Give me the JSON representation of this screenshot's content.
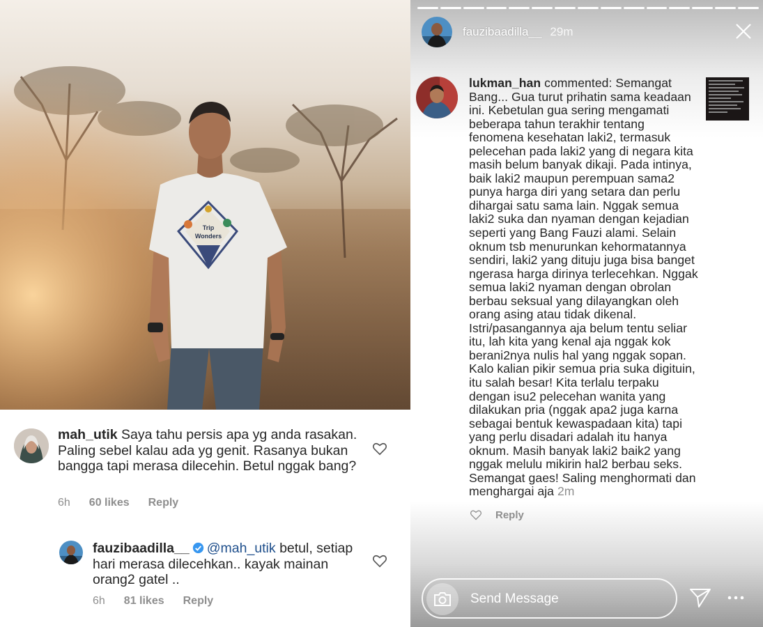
{
  "left_post": {
    "comments": [
      {
        "username": "mah_utik",
        "text": "Saya tahu persis apa yg anda rasakan. Paling sebel kalau ada yg genit. Rasanya bukan bangga tapi merasa dilecehin. Betul nggak bang?",
        "time": "6h",
        "likes": "60 likes",
        "reply": "Reply"
      },
      {
        "username": "fauzibaadilla__",
        "mention": "@mah_utik",
        "text": "betul, setiap hari merasa dilecehkan.. kayak mainan orang2 gatel ..",
        "time": "6h",
        "likes": "81 likes",
        "reply": "Reply"
      }
    ],
    "shirt_print": {
      "line1": "Trip",
      "line2": "Wonders"
    }
  },
  "story": {
    "username": "fauzibaadilla__",
    "time": "29m",
    "segments_total": 15,
    "segments_viewed": 15,
    "comment": {
      "username": "lukman_han",
      "text": "commented: Semangat Bang... Gua turut prihatin sama keadaan ini. Kebetulan gua sering mengamati beberapa tahun terakhir tentang fenomena kesehatan laki2, termasuk pelecehan pada laki2 yang di negara kita masih belum banyak dikaji. Pada intinya, baik laki2 maupun perempuan sama2 punya harga diri yang setara dan perlu dihargai satu sama lain. Nggak semua laki2 suka dan nyaman dengan kejadian seperti yang Bang Fauzi alami. Selain oknum tsb menurunkan kehormatannya sendiri, laki2 yang dituju juga bisa banget ngerasa harga dirinya terlecehkan. Nggak semua laki2 nyaman dengan obrolan berbau seksual yang dilayangkan oleh orang asing atau tidak dikenal. Istri/pasangannya aja belum tentu seliar itu, lah kita yang kenal aja nggak kok berani2nya nulis hal yang nggak sopan. Kalo kalian pikir semua pria suka digituin, itu salah besar! Kita terlalu terpaku dengan isu2 pelecehan wanita yang dilakukan pria (nggak apa2 juga karna sebagai bentuk kewaspadaan kita) tapi yang perlu disadari adalah itu hanya oknum. Masih banyak laki2 baik2 yang nggak melulu mikirin hal2 berbau seks. Semangat gaes! Saling menghormati dan menghargai aja",
      "time": "2m",
      "reply": "Reply"
    },
    "message_placeholder": "Send Message"
  },
  "colors": {
    "text_primary": "#262626",
    "text_secondary": "#8e8e8e",
    "mention": "#1f4f8c",
    "verified": "#3897f0"
  }
}
